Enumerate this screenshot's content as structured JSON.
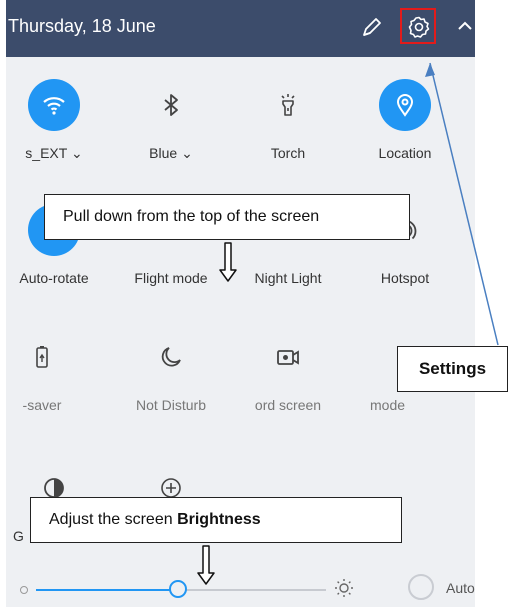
{
  "header": {
    "date": "Thursday, 18 June"
  },
  "tiles": [
    {
      "label": "s_EXT ⌄",
      "icon": "wifi-icon"
    },
    {
      "label": "Blue ⌄",
      "icon": "bluetooth-icon"
    },
    {
      "label": "Torch",
      "icon": "torch-icon"
    },
    {
      "label": "Location",
      "icon": "location-icon"
    },
    {
      "label": "Auto-rotate",
      "icon": "auto-rotate-icon"
    },
    {
      "label": "Flight mode",
      "icon": "airplane-icon"
    },
    {
      "label": "Night Light",
      "icon": "night-light-icon"
    },
    {
      "label": "Hotspot",
      "icon": "hotspot-icon"
    },
    {
      "label": "-saver",
      "icon": "battery-saver-icon"
    },
    {
      "label": "Not Disturb",
      "icon": "moon-icon"
    },
    {
      "label": "ord screen",
      "icon": "screen-record-icon"
    },
    {
      "label": "mode",
      "icon": "mode-icon"
    },
    {
      "label": "G",
      "icon": "contrast-icon"
    },
    {
      "label": "",
      "icon": "add-icon"
    }
  ],
  "callouts": {
    "pull_down": "Pull down from the top of the screen",
    "brightness_prefix": "Adjust the screen ",
    "brightness_bold": "Brightness",
    "settings": "Settings"
  },
  "brightness": {
    "level": 0.47,
    "auto_label": "Auto"
  },
  "colors": {
    "header": "#3c4c6b",
    "accent": "#2196f3",
    "highlight": "#e21b1b"
  }
}
